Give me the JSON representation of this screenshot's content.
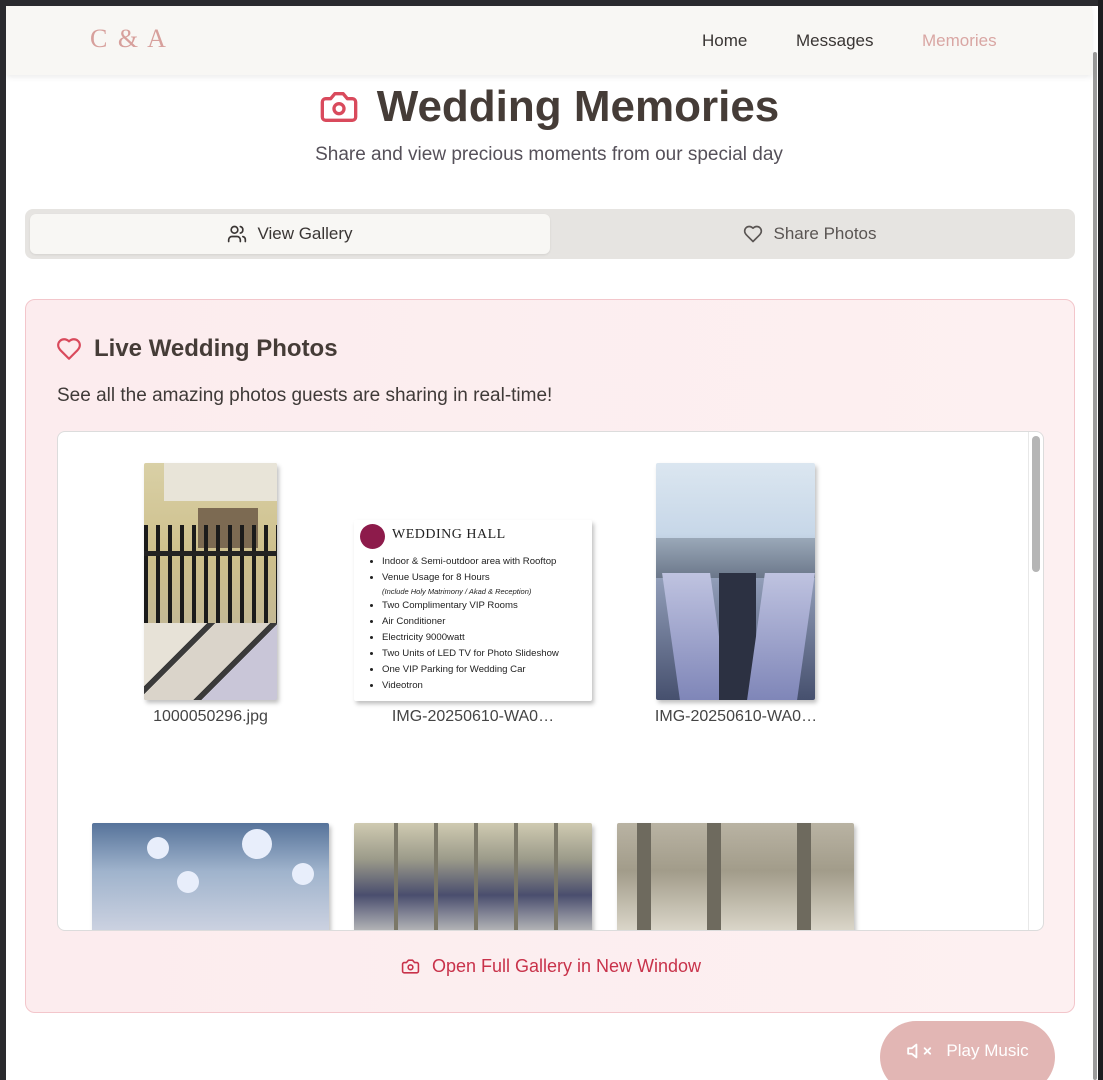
{
  "nav": {
    "brand": "C & A",
    "links": [
      "Home",
      "Messages",
      "Memories"
    ],
    "active": "Memories"
  },
  "hero": {
    "title": "Wedding Memories",
    "subtitle": "Share and view precious moments from our special day",
    "icon": "camera-icon"
  },
  "tabs": [
    {
      "label": "View Gallery",
      "icon": "users-icon",
      "active": true
    },
    {
      "label": "Share Photos",
      "icon": "heart-icon",
      "active": false
    }
  ],
  "card": {
    "title": "Live Wedding Photos",
    "description": "See all the amazing photos guests are sharing in real-time!",
    "photos": [
      {
        "caption": "1000050296.jpg"
      },
      {
        "caption": "IMG-20250610-WA0…"
      },
      {
        "caption": "IMG-20250610-WA0…"
      }
    ],
    "hall_card": {
      "title": "WEDDING HALL",
      "items": [
        "Indoor & Semi-outdoor area with Rooftop",
        "Venue Usage for 8 Hours",
        "(Include Holy Matrimony / Akad & Reception)",
        "Two Complimentary VIP Rooms",
        "Air Conditioner",
        "Electricity 9000watt",
        "Two Units of LED TV for Photo Slideshow",
        "One VIP Parking for Wedding Car",
        "Videotron"
      ]
    },
    "open_link": "Open Full Gallery in New Window"
  },
  "music": {
    "label": "Play Music",
    "icon": "volume-muted-icon"
  },
  "colors": {
    "accent": "#c8324a",
    "brand": "#d7a09c",
    "card_bg": "#fcecee",
    "music_bg": "#e2b6b4"
  }
}
